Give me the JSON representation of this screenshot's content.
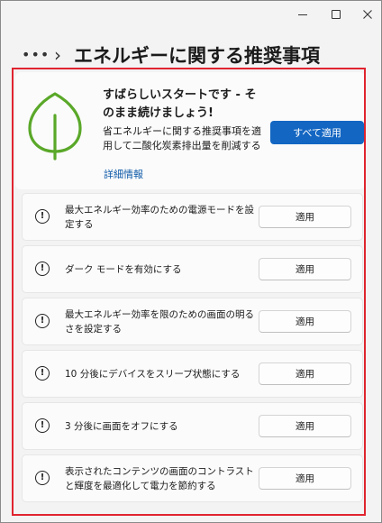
{
  "header": {
    "more_glyph": "•••",
    "chevron_glyph": "›",
    "title": "エネルギーに関する推奨事項"
  },
  "hero": {
    "title": "すばらしいスタートです - そのまま続けましょう!",
    "description": "省エネルギーに関する推奨事項を適用して二酸化炭素排出量を削減する",
    "more_link": "詳細情報",
    "apply_all": "すべて適用",
    "leaf_color": "#5aa829"
  },
  "recommendations": [
    {
      "text": "最大エネルギー効率のための電源モードを設定する",
      "button": "適用"
    },
    {
      "text": "ダーク モードを有効にする",
      "button": "適用"
    },
    {
      "text": "最大エネルギー効率を限のための画面の明るさを設定する",
      "button": "適用"
    },
    {
      "text": "10 分後にデバイスをスリープ状態にする",
      "button": "適用"
    },
    {
      "text": "3 分後に画面をオフにする",
      "button": "適用"
    },
    {
      "text": "表示されたコンテンツの画面のコントラストと輝度を最適化して電力を節約する",
      "button": "適用"
    }
  ],
  "icons": {
    "warning_glyph": "!"
  },
  "colors": {
    "accent": "#1366c2",
    "highlight_frame": "#e0242f"
  }
}
